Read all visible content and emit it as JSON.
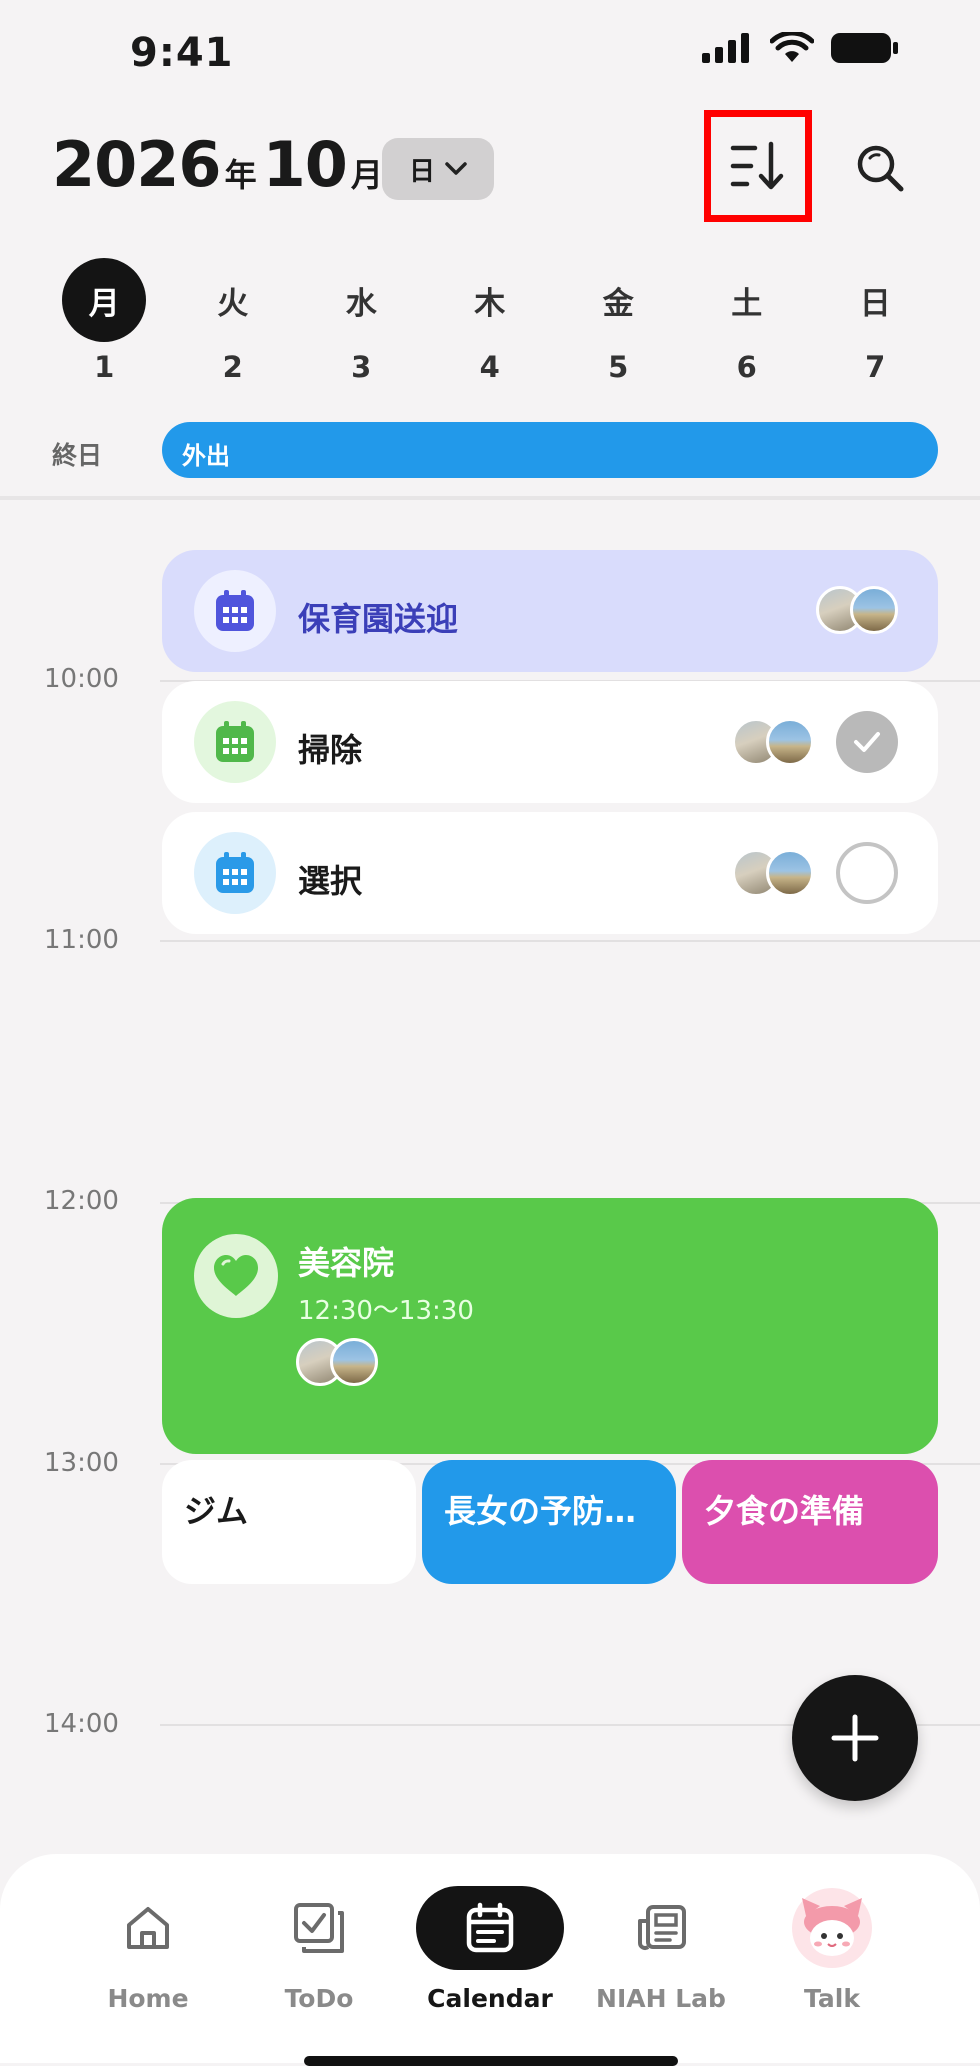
{
  "status_bar": {
    "time": "9:41"
  },
  "header": {
    "year": "2026",
    "year_suffix": "年",
    "month": "10",
    "month_suffix": "月",
    "view_mode": "日",
    "icons": [
      "sort-icon",
      "search-icon",
      "chevron-down-icon"
    ]
  },
  "week": [
    {
      "weekday": "月",
      "date": "1",
      "selected": true
    },
    {
      "weekday": "火",
      "date": "2"
    },
    {
      "weekday": "水",
      "date": "3"
    },
    {
      "weekday": "木",
      "date": "4"
    },
    {
      "weekday": "金",
      "date": "5"
    },
    {
      "weekday": "土",
      "date": "6"
    },
    {
      "weekday": "日",
      "date": "7"
    }
  ],
  "all_day": {
    "label": "終日",
    "event": "外出",
    "color": "#2299ea"
  },
  "hours": [
    "10:00",
    "11:00",
    "12:00",
    "13:00",
    "14:00"
  ],
  "tasks": [
    {
      "title": "保育園送迎",
      "color": "#4a4fd8",
      "bg": "#d9dcfc",
      "icon_bg": "#eef0ff"
    },
    {
      "title": "掃除",
      "color": "#50b84a",
      "status": "done",
      "icon_bg": "#e3f7de"
    },
    {
      "title": "選択",
      "color": "#2a9ae8",
      "status": "open",
      "icon_bg": "#ddf0fc"
    }
  ],
  "appointment": {
    "title": "美容院",
    "time_range": "12:30～13:30",
    "color": "#59c94a",
    "icon": "heart-icon"
  },
  "mini_events": [
    {
      "title": "ジム",
      "bg": "#ffffff",
      "color": "#1a1a1a"
    },
    {
      "title": "長女の予防…",
      "bg": "#2299ea",
      "color": "#ffffff"
    },
    {
      "title": "夕食の準備",
      "bg": "#dc4fae",
      "color": "#ffffff"
    }
  ],
  "fab": {
    "icon": "plus-icon"
  },
  "tabbar": [
    {
      "label": "Home",
      "icon": "home-icon"
    },
    {
      "label": "ToDo",
      "icon": "todo-icon"
    },
    {
      "label": "Calendar",
      "icon": "calendar-icon",
      "active": true
    },
    {
      "label": "NIAH Lab",
      "icon": "news-icon"
    },
    {
      "label": "Talk",
      "icon": "mascot-icon"
    }
  ]
}
